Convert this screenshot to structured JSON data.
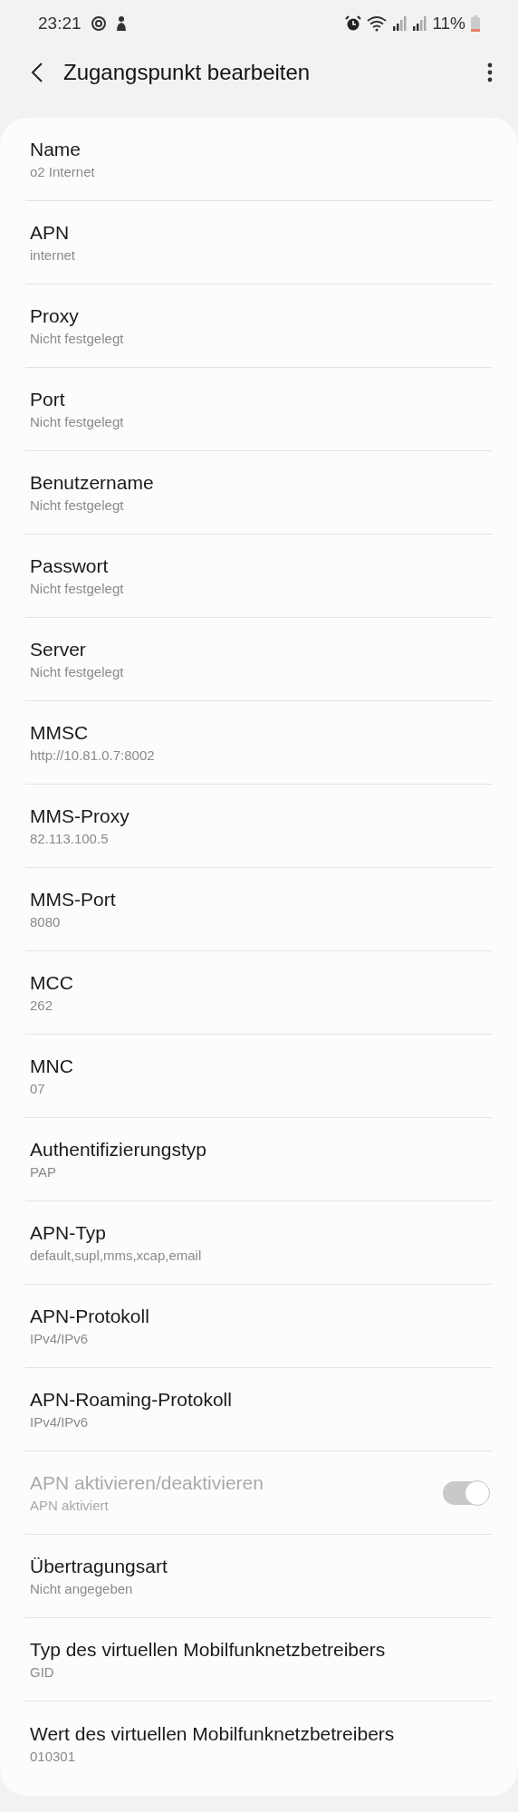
{
  "status_bar": {
    "time": "23:21",
    "battery": "11%"
  },
  "header": {
    "title": "Zugangspunkt bearbeiten"
  },
  "settings": [
    {
      "kind": "text",
      "title": "Name",
      "value": "o2 Internet"
    },
    {
      "kind": "text",
      "title": "APN",
      "value": "internet"
    },
    {
      "kind": "text",
      "title": "Proxy",
      "value": "Nicht festgelegt"
    },
    {
      "kind": "text",
      "title": "Port",
      "value": "Nicht festgelegt"
    },
    {
      "kind": "text",
      "title": "Benutzername",
      "value": "Nicht festgelegt"
    },
    {
      "kind": "text",
      "title": "Passwort",
      "value": "Nicht festgelegt"
    },
    {
      "kind": "text",
      "title": "Server",
      "value": "Nicht festgelegt"
    },
    {
      "kind": "text",
      "title": "MMSC",
      "value": "http://10.81.0.7:8002"
    },
    {
      "kind": "text",
      "title": "MMS-Proxy",
      "value": "82.113.100.5"
    },
    {
      "kind": "text",
      "title": "MMS-Port",
      "value": "8080"
    },
    {
      "kind": "text",
      "title": "MCC",
      "value": "262"
    },
    {
      "kind": "text",
      "title": "MNC",
      "value": "07"
    },
    {
      "kind": "text",
      "title": "Authentifizierungstyp",
      "value": "PAP"
    },
    {
      "kind": "text",
      "title": "APN-Typ",
      "value": "default,supl,mms,xcap,email"
    },
    {
      "kind": "text",
      "title": "APN-Protokoll",
      "value": "IPv4/IPv6"
    },
    {
      "kind": "text",
      "title": "APN-Roaming-Protokoll",
      "value": "IPv4/IPv6"
    },
    {
      "kind": "switch",
      "title": "APN aktivieren/deaktivieren",
      "value": "APN aktiviert",
      "on": true,
      "disabled": true
    },
    {
      "kind": "text",
      "title": "Übertragungsart",
      "value": "Nicht angegeben"
    },
    {
      "kind": "text",
      "title": "Typ des virtuellen Mobilfunknetzbetreibers",
      "value": "GID"
    },
    {
      "kind": "text",
      "title": "Wert des virtuellen Mobilfunknetzbetreibers",
      "value": "010301"
    }
  ]
}
